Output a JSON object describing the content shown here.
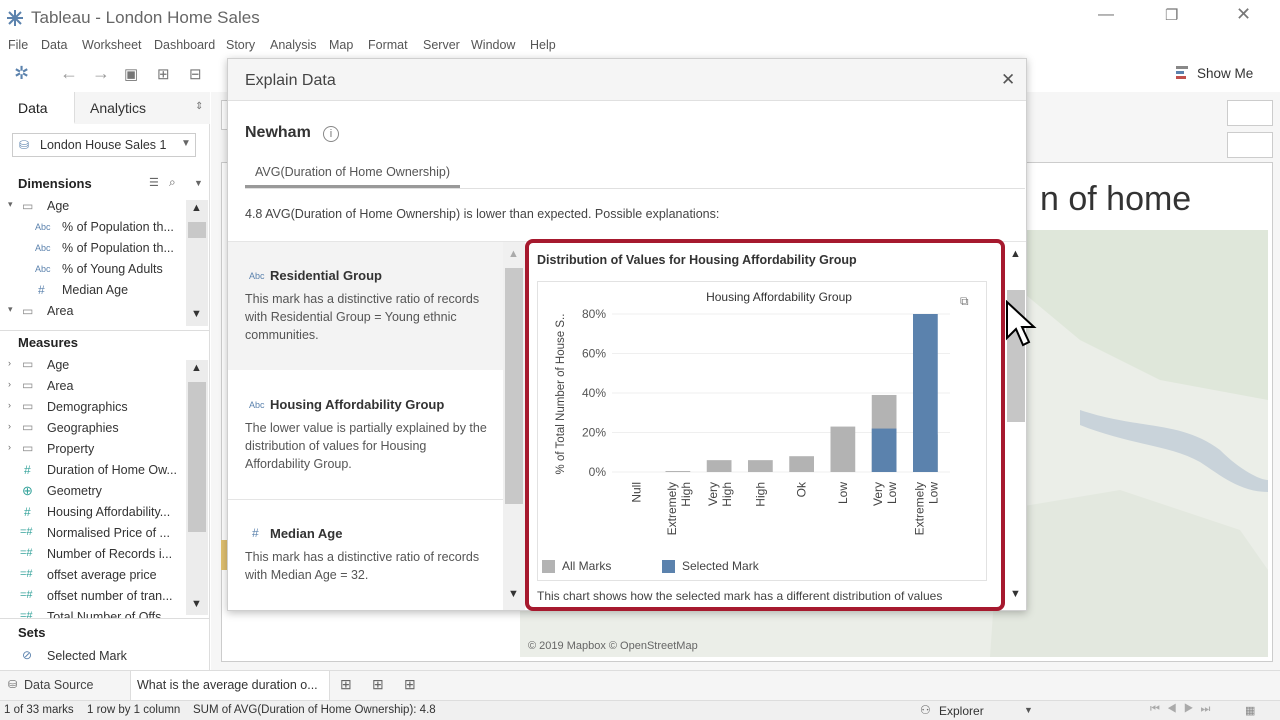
{
  "window": {
    "title": "Tableau - London Home Sales"
  },
  "menu": [
    "File",
    "Data",
    "Worksheet",
    "Dashboard",
    "Story",
    "Analysis",
    "Map",
    "Format",
    "Server",
    "Window",
    "Help"
  ],
  "toolbar": {
    "show_me": "Show Me"
  },
  "left_pane": {
    "tab_data": "Data",
    "tab_analytics": "Analytics",
    "datasource": "London House Sales 1",
    "dimensions_title": "Dimensions",
    "dimensions": [
      {
        "label": "Age",
        "type": "folder"
      },
      {
        "label": "% of Population th...",
        "type": "Abc"
      },
      {
        "label": "% of Population th...",
        "type": "Abc"
      },
      {
        "label": "% of Young Adults",
        "type": "Abc"
      },
      {
        "label": "Median Age",
        "type": "#"
      },
      {
        "label": "Area",
        "type": "folder"
      }
    ],
    "measures_title": "Measures",
    "measures": [
      {
        "label": "Age",
        "type": "folder"
      },
      {
        "label": "Area",
        "type": "folder"
      },
      {
        "label": "Demographics",
        "type": "folder"
      },
      {
        "label": "Geographies",
        "type": "folder"
      },
      {
        "label": "Property",
        "type": "folder"
      },
      {
        "label": "Duration of Home Ow...",
        "type": "#"
      },
      {
        "label": "Geometry",
        "type": "globe"
      },
      {
        "label": "Housing Affordability...",
        "type": "#"
      },
      {
        "label": "Normalised Price of ...",
        "type": "=#"
      },
      {
        "label": "Number of Records i...",
        "type": "=#"
      },
      {
        "label": "offset average price",
        "type": "=#"
      },
      {
        "label": "offset number of tran...",
        "type": "=#"
      },
      {
        "label": "Total Number of Offs...",
        "type": "=#"
      }
    ],
    "sets_title": "Sets",
    "sets": [
      {
        "label": "Selected Mark"
      }
    ]
  },
  "worksheet": {
    "title_fragment": "n of home",
    "map_credit": "© 2019 Mapbox © OpenStreetMap"
  },
  "dialog": {
    "title": "Explain Data",
    "mark": "Newham",
    "tab": "AVG(Duration of Home Ownership)",
    "summary": "4.8 AVG(Duration of Home Ownership) is lower than expected. Possible explanations:",
    "explanations": [
      {
        "type": "Abc",
        "title": "Residential Group",
        "body": "This mark has a distinctive ratio of records with Residential Group = Young ethnic communities."
      },
      {
        "type": "Abc",
        "title": "Housing Affordability Group",
        "body": "The lower value is partially explained by the distribution of values for Housing Affordability Group."
      },
      {
        "type": "#",
        "title": "Median Age",
        "body": "This mark has a distinctive ratio of records with Median Age = 32."
      }
    ],
    "viz_title": "Distribution of Values for Housing Affordability Group",
    "viz_footer": "This chart shows how the selected mark has a different distribution of values"
  },
  "chart_data": {
    "type": "bar",
    "title": "Housing Affordability Group",
    "ylabel": "% of Total Number of House S..",
    "yticks": [
      "0%",
      "20%",
      "40%",
      "60%",
      "80%"
    ],
    "ylim": [
      0,
      80
    ],
    "categories": [
      "Null",
      "Extremely High",
      "Very High",
      "High",
      "Ok",
      "Low",
      "Very Low",
      "Extremely Low"
    ],
    "series": [
      {
        "name": "All Marks",
        "color": "#b3b3b3",
        "values": [
          0,
          0.5,
          6,
          6,
          8,
          23,
          39,
          19
        ]
      },
      {
        "name": "Selected Mark",
        "color": "#5b82ad",
        "values": [
          0,
          0,
          0,
          0,
          0,
          0,
          22,
          80
        ]
      }
    ]
  },
  "tabs_bottom": {
    "datasource": "Data Source",
    "sheet": "What is the average duration o..."
  },
  "status": {
    "marks": "1 of 33 marks",
    "rows": "1 row by 1 column",
    "sum": "SUM of AVG(Duration of Home Ownership): 4.8",
    "user": "Explorer"
  }
}
